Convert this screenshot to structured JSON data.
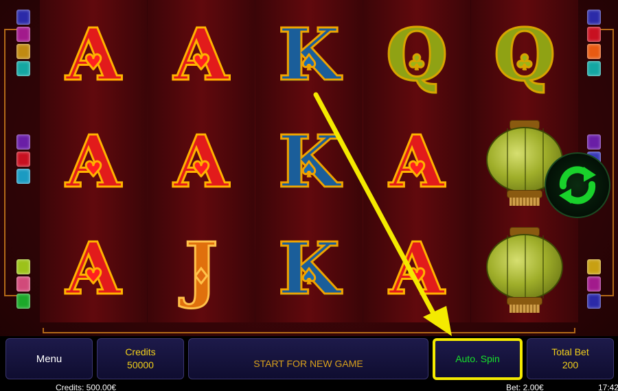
{
  "colors": {
    "highlight": "#f4ea00",
    "credits_text": "#f3d11a",
    "auto_spin_text": "#17e22a",
    "spin_icon": "#19d12b",
    "button_bg": "#1d1a4a"
  },
  "reels": [
    [
      "A",
      "A",
      "A"
    ],
    [
      "A",
      "A",
      "J"
    ],
    [
      "K",
      "K",
      "K"
    ],
    [
      "Q",
      "A",
      "A"
    ],
    [
      "Q",
      "lantern",
      "lantern"
    ]
  ],
  "symbols": {
    "A": {
      "letter": "A",
      "suit": "♥",
      "icon": "heart-icon"
    },
    "K": {
      "letter": "K",
      "suit": "♠",
      "icon": "spade-icon"
    },
    "Q": {
      "letter": "Q",
      "suit": "♣",
      "icon": "club-icon"
    },
    "J": {
      "letter": "J",
      "suit": "♦",
      "icon": "diamond-icon"
    },
    "lantern": {
      "icon": "lantern-icon"
    }
  },
  "markers": {
    "left_top": [
      "#2b2aa8",
      "#a21a8c",
      "#c08a12",
      "#14a6a2"
    ],
    "left_mid": [
      "#6a1ea6",
      "#c81020",
      "#1b9bc2"
    ],
    "left_bottom": [
      "#9cc21a",
      "#d14a7a",
      "#1ca82a"
    ],
    "right_top": [
      "#2b2aa8",
      "#c81020",
      "#e85a12",
      "#14a6a2"
    ],
    "right_mid": [
      "#6a1ea6",
      "#3a3ab8"
    ],
    "right_bottom": [
      "#c8a012",
      "#a21a8c",
      "#2b2aa8"
    ]
  },
  "spin_button": {
    "icon": "refresh-icon"
  },
  "bottom_bar": {
    "menu_label": "Menu",
    "credits_label": "Credits",
    "credits_value": "50000",
    "start_label": "START FOR NEW GAME",
    "auto_spin_label": "Auto. Spin",
    "total_bet_label": "Total Bet",
    "total_bet_value": "200"
  },
  "status_bar": {
    "credits": "Credits: 500.00€",
    "bet": "Bet: 2.00€",
    "time": "17:42"
  }
}
